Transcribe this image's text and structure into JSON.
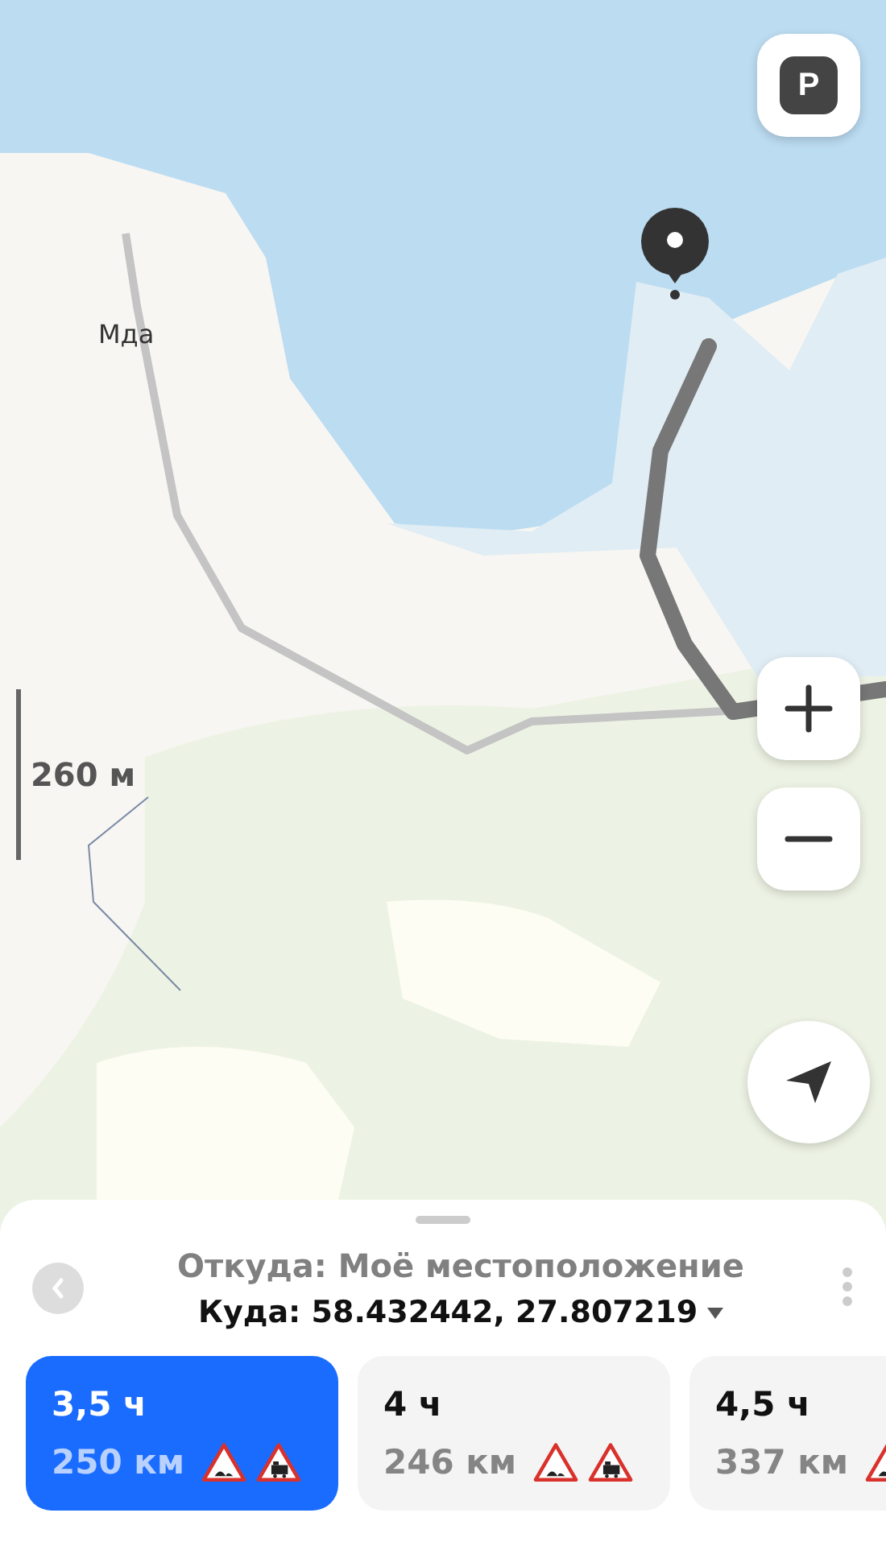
{
  "map": {
    "place_label": "Мда",
    "scale": "260 м",
    "parking_button": "P"
  },
  "sheet": {
    "from": "Откуда: Моё местоположение",
    "to": "Куда: 58.432442, 27.807219"
  },
  "routes": [
    {
      "time": "3,5 ч",
      "distance": "250 км",
      "selected": true,
      "warnings": [
        {
          "kind": "bump"
        },
        {
          "kind": "railway"
        }
      ]
    },
    {
      "time": "4 ч",
      "distance": "246 км",
      "selected": false,
      "warnings": [
        {
          "kind": "bump"
        },
        {
          "kind": "railway"
        }
      ]
    },
    {
      "time": "4,5 ч",
      "distance": "337 км",
      "selected": false,
      "warnings": [
        {
          "kind": "bump"
        }
      ]
    }
  ]
}
